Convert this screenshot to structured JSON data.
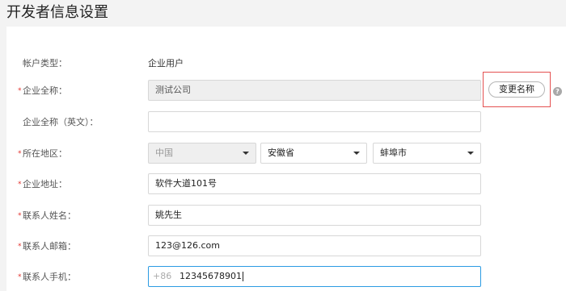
{
  "page": {
    "title": "开发者信息设置"
  },
  "form": {
    "account_type": {
      "label": "帐户类型：",
      "value": "企业用户"
    },
    "company_name": {
      "label": "企业全称：",
      "value": "测试公司",
      "change_button": "变更名称",
      "help_icon": "?"
    },
    "company_name_en": {
      "label": "企业全称（英文）：",
      "value": ""
    },
    "region": {
      "label": "所在地区：",
      "country": "中国",
      "province": "安徽省",
      "city": "蚌埠市"
    },
    "address": {
      "label": "企业地址：",
      "value": "软件大道101号"
    },
    "contact_name": {
      "label": "联系人姓名：",
      "value": "姚先生"
    },
    "contact_email": {
      "label": "联系人邮箱：",
      "value": "123@126.com"
    },
    "contact_phone": {
      "label": "联系人手机：",
      "prefix": "+86",
      "value": "12345678901"
    },
    "required_mark": "*"
  }
}
